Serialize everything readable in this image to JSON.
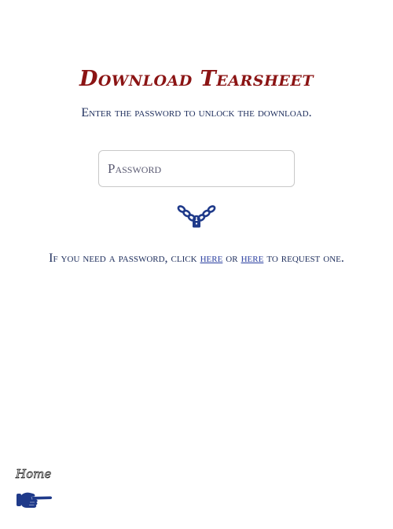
{
  "header": {
    "title": "Download Tearsheet"
  },
  "instruction": "Enter the password to unlock the download.",
  "form": {
    "password_placeholder": "Password",
    "password_value": ""
  },
  "icons": {
    "unlock": "chain-padlock-icon",
    "home": "pointing-hand-icon",
    "accent_color": "#1f3a8a",
    "title_color": "#8b1414"
  },
  "request": {
    "prefix": "If you need a password, click ",
    "link1": "here",
    "middle": " or ",
    "link2": "here",
    "suffix": " to request one."
  },
  "footer": {
    "home_label": "Home"
  }
}
